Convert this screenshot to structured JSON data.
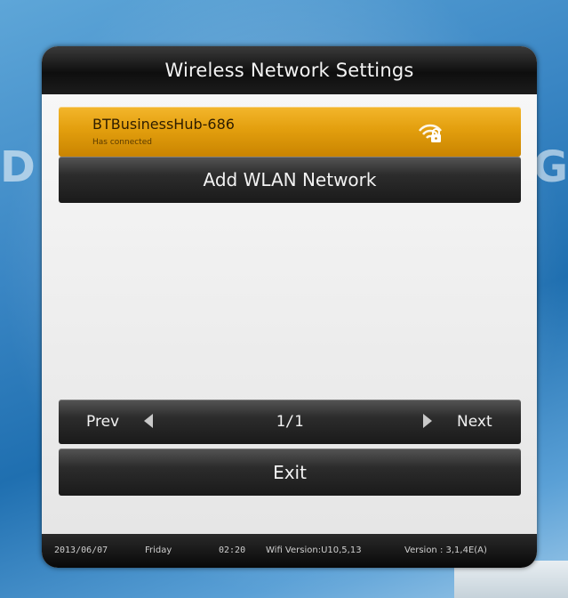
{
  "background": {
    "left_letter": "D",
    "right_letter": "G"
  },
  "dialog": {
    "title": "Wireless Network Settings",
    "network": {
      "name": "BTBusinessHub-686",
      "status": "Has connected",
      "icon": "wifi-lock-icon"
    },
    "add_network_label": "Add WLAN Network",
    "pager": {
      "prev_label": "Prev",
      "page": "1/1",
      "next_label": "Next"
    },
    "exit_label": "Exit"
  },
  "status_bar": {
    "date": "2013/06/07",
    "day": "Friday",
    "time": "02:20",
    "wifi_version": "Wifi Version:U10,5,13",
    "version": "Version : 3,1,4E(A)"
  },
  "colors": {
    "selected_item": "#e39f0e",
    "bar_dark": "#1a1a1a",
    "content_bg": "#efefef"
  }
}
